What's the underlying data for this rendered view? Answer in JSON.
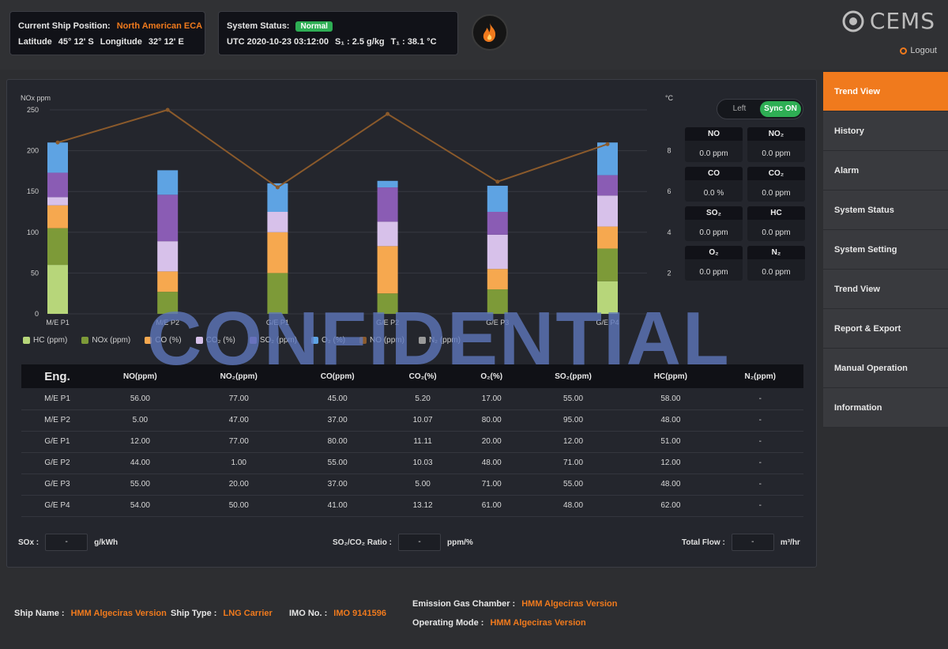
{
  "header": {
    "position_label": "Current Ship Position:",
    "position_value": "North American ECA",
    "latitude_label": "Latitude",
    "latitude_value": "45° 12' S",
    "longitude_label": "Longitude",
    "longitude_value": "32° 12' E",
    "status_label": "System Status:",
    "status_value": "Normal",
    "utc": "UTC 2020-10-23 03:12:00",
    "s_reading": "S₁ : 2.5 g/kg",
    "t_reading": "T₁ : 38.1 °C",
    "logo_text": "CEMS",
    "logout_label": "Logout"
  },
  "toggle": {
    "left": "Left",
    "right": "Sync ON"
  },
  "stats": [
    {
      "label": "NO",
      "value": "0.0 ppm"
    },
    {
      "label": "NO₂",
      "value": "0.0 ppm"
    },
    {
      "label": "CO",
      "value": "0.0 %"
    },
    {
      "label": "CO₂",
      "value": "0.0 ppm"
    },
    {
      "label": "SO₂",
      "value": "0.0 ppm"
    },
    {
      "label": "HC",
      "value": "0.0 ppm"
    },
    {
      "label": "O₂",
      "value": "0.0 ppm"
    },
    {
      "label": "N₂",
      "value": "0.0 ppm"
    }
  ],
  "chart_data": {
    "type": "bar",
    "stacked": true,
    "categories": [
      "M/E P1",
      "M/E P2",
      "G/E P1",
      "G/E P2",
      "G/E P3",
      "G/E P4"
    ],
    "ylabel_left": "NOx ppm",
    "ylabel_right": "°C",
    "ylim": [
      0,
      250
    ],
    "y_ticks": [
      0,
      50,
      100,
      150,
      200,
      250
    ],
    "y2_ticks": [
      2,
      4,
      6,
      8
    ],
    "series": [
      {
        "name": "HC (ppm)",
        "color": "#b7d67a",
        "values": [
          60,
          0,
          0,
          0,
          0,
          40
        ]
      },
      {
        "name": "NOx (ppm)",
        "color": "#7d9a38",
        "values": [
          45,
          27,
          50,
          25,
          30,
          40
        ]
      },
      {
        "name": "CO (%)",
        "color": "#f6a84f",
        "values": [
          28,
          25,
          50,
          58,
          25,
          27
        ]
      },
      {
        "name": "CO₂ (%)",
        "color": "#d7c1ea",
        "values": [
          10,
          37,
          25,
          30,
          42,
          38
        ]
      },
      {
        "name": "SO₂ (ppm)",
        "color": "#8a5cb4",
        "values": [
          30,
          57,
          0,
          42,
          28,
          25
        ]
      },
      {
        "name": "O₂ (%)",
        "color": "#5ea3e3",
        "values": [
          37,
          30,
          35,
          8,
          32,
          40
        ]
      }
    ],
    "line_series": {
      "name": "NO (ppm)",
      "color": "#8b5a2b",
      "values": [
        210,
        250,
        155,
        245,
        162,
        208
      ]
    },
    "legend": [
      "HC (ppm)",
      "NOx (ppm)",
      "CO (%)",
      "CO₂ (%)",
      "SO₂ (ppm)",
      "O₂ (%)",
      "NO (ppm)",
      "N₂ (ppm)"
    ],
    "grid": true
  },
  "table": {
    "headers": [
      "Eng.",
      "NO(ppm)",
      "NO₂(ppm)",
      "CO(ppm)",
      "CO₂(%)",
      "O₂(%)",
      "SO₂(ppm)",
      "HC(ppm)",
      "N₂(ppm)"
    ],
    "rows": [
      [
        "M/E P1",
        "56.00",
        "77.00",
        "45.00",
        "5.20",
        "17.00",
        "55.00",
        "58.00",
        "-"
      ],
      [
        "M/E P2",
        "5.00",
        "47.00",
        "37.00",
        "10.07",
        "80.00",
        "95.00",
        "48.00",
        "-"
      ],
      [
        "G/E P1",
        "12.00",
        "77.00",
        "80.00",
        "11.11",
        "20.00",
        "12.00",
        "51.00",
        "-"
      ],
      [
        "G/E P2",
        "44.00",
        "1.00",
        "55.00",
        "10.03",
        "48.00",
        "71.00",
        "12.00",
        "-"
      ],
      [
        "G/E P3",
        "55.00",
        "20.00",
        "37.00",
        "5.00",
        "71.00",
        "55.00",
        "48.00",
        "-"
      ],
      [
        "G/E P4",
        "54.00",
        "50.00",
        "41.00",
        "13.12",
        "61.00",
        "48.00",
        "62.00",
        "-"
      ]
    ]
  },
  "bottom": {
    "sox_label": "SOx :",
    "sox_value": "-",
    "sox_unit": "g/kWh",
    "ratio_label": "SO₂/CO₂ Ratio :",
    "ratio_value": "-",
    "ratio_unit": "ppm/%",
    "flow_label": "Total Flow :",
    "flow_value": "-",
    "flow_unit": "m³/hr"
  },
  "sidebar": [
    {
      "label": "Trend View"
    },
    {
      "label": "History"
    },
    {
      "label": "Alarm"
    },
    {
      "label": "System Status"
    },
    {
      "label": "System Setting"
    },
    {
      "label": "Trend View"
    },
    {
      "label": "Report & Export"
    },
    {
      "label": "Manual Operation"
    },
    {
      "label": "Information"
    }
  ],
  "watermark": "CONFIDENTIAL",
  "footer": {
    "ship_name_label": "Ship Name :",
    "ship_name_value": "HMM Algeciras Version",
    "ship_type_label": "Ship Type :",
    "ship_type_value": "LNG Carrier",
    "imo_label": "IMO No. :",
    "imo_value": "IMO 9141596",
    "emission_label": "Emission Gas Chamber :",
    "emission_value": "HMM Algeciras Version",
    "mode_label": "Operating Mode :",
    "mode_value": "HMM Algeciras Version"
  },
  "colors": {
    "accent": "#f07a1d",
    "status_green": "#2eae54",
    "panel": "#24262d"
  }
}
